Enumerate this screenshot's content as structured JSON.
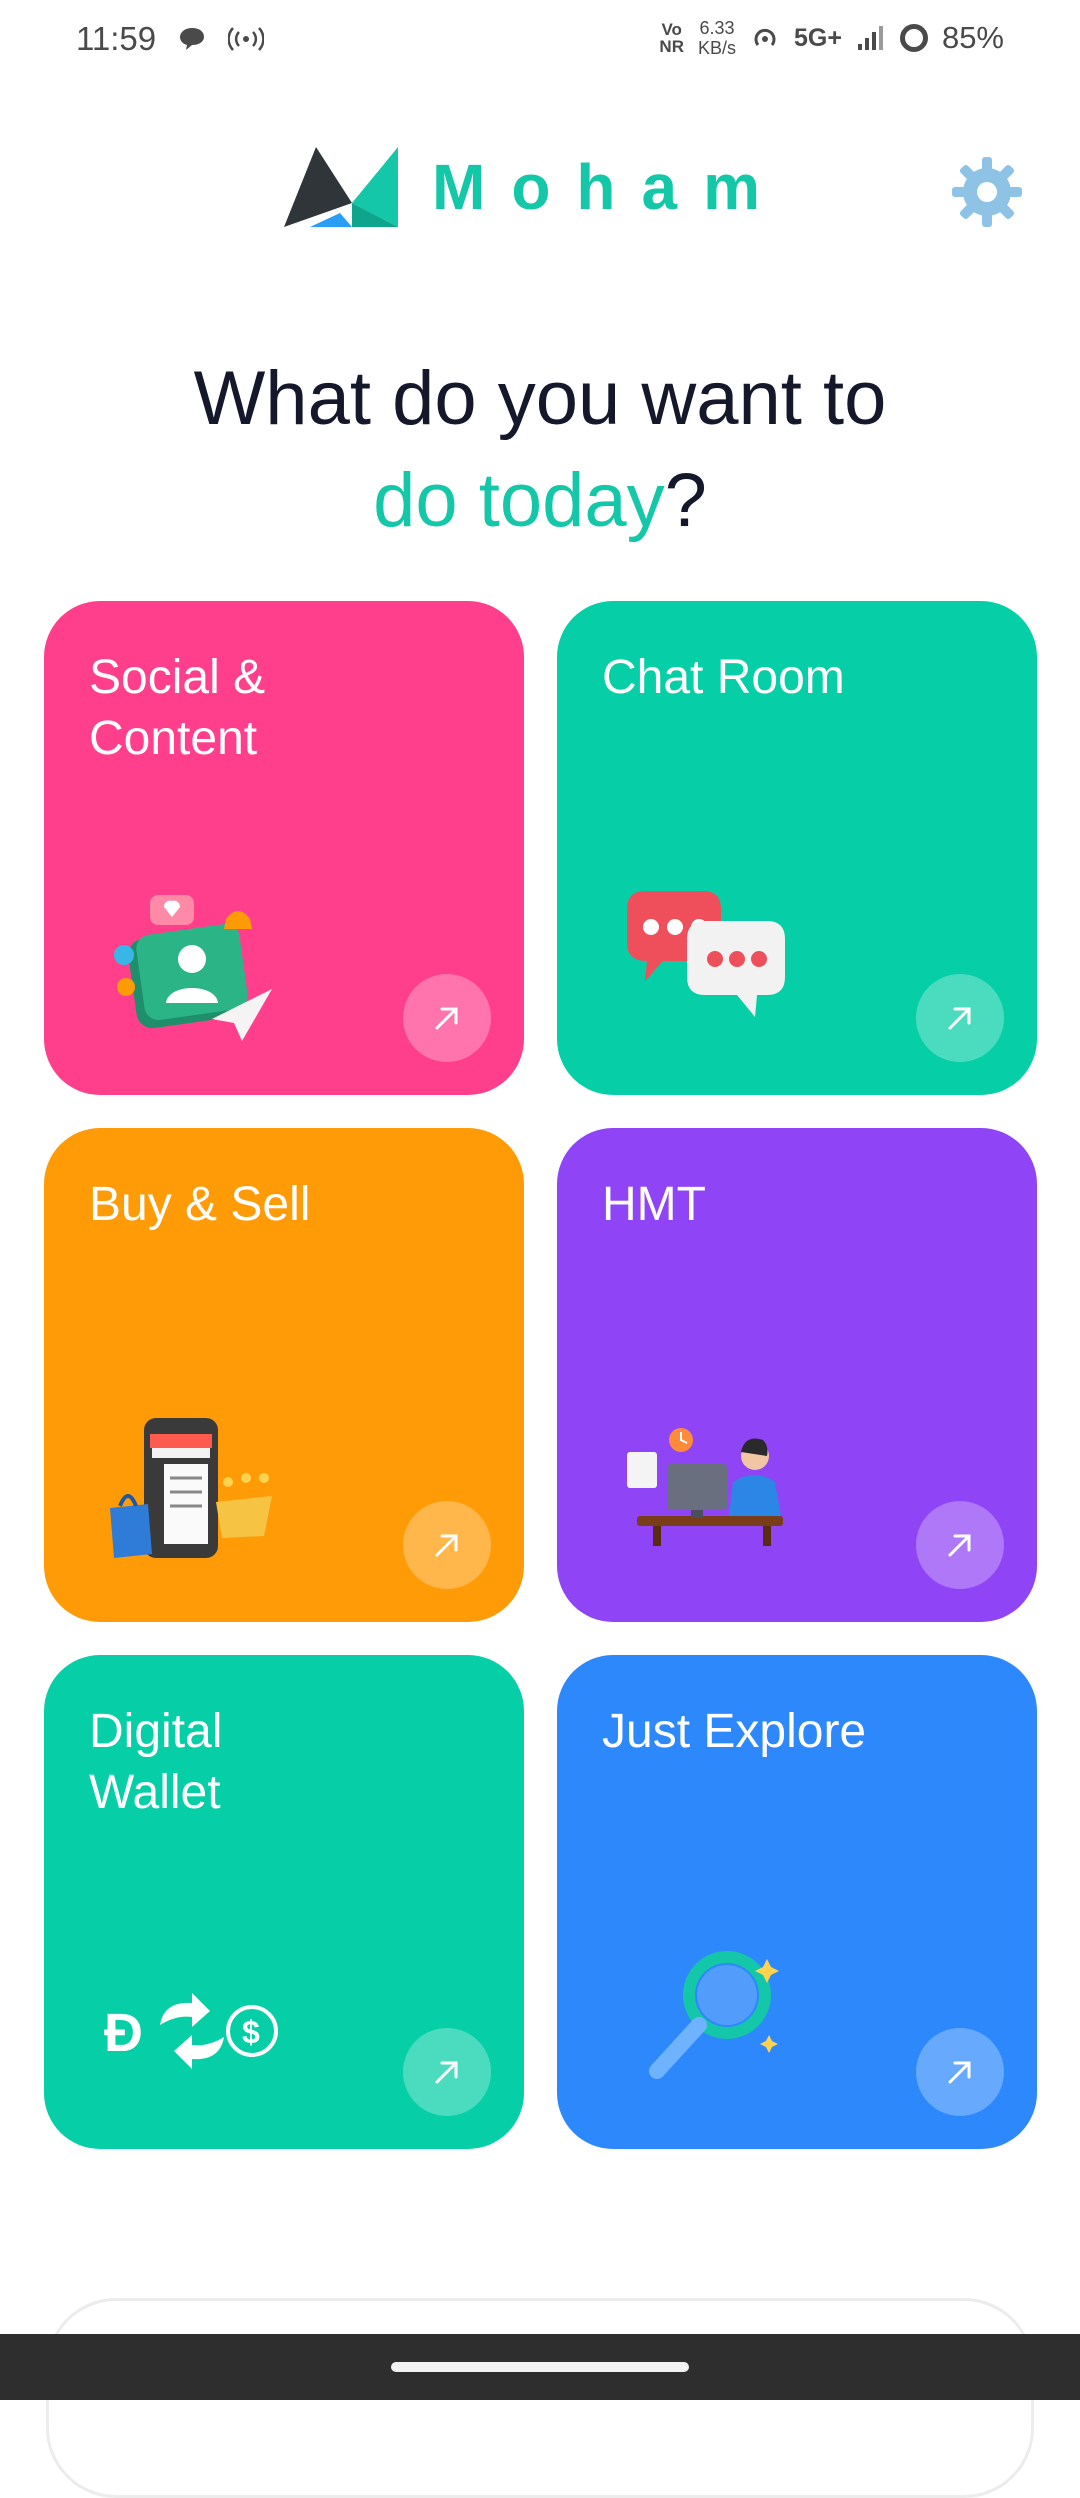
{
  "status_bar": {
    "time": "11:59",
    "volte_top": "Vo",
    "volte_bottom": "NR",
    "speed_value": "6.33",
    "speed_unit": "KB/s",
    "network": "5G+",
    "battery": "85%",
    "icons": [
      "chat-bubble-icon",
      "hotspot-icon",
      "wifi-calling-icon",
      "signal-icon",
      "battery-icon"
    ]
  },
  "header": {
    "brand": "Moham",
    "brand_color": "#14c7a8",
    "settings_icon": "gear-icon"
  },
  "heading": {
    "line1": "What do you want to",
    "accent": "do today",
    "question_mark": "?"
  },
  "cards": [
    {
      "title": "Social &\nContent",
      "color": "#ff3f8c",
      "icon": "social-profile-icon"
    },
    {
      "title": "Chat Room",
      "color": "#06cfa8",
      "icon": "chat-bubbles-icon"
    },
    {
      "title": "Buy & Sell",
      "color": "#ff9b07",
      "icon": "shopping-icon"
    },
    {
      "title": "HMT",
      "color": "#8f45f6",
      "icon": "person-at-computer-icon"
    },
    {
      "title": "Digital\nWallet",
      "color": "#06cfa8",
      "icon": "currency-exchange-icon"
    },
    {
      "title": "Just Explore",
      "color": "#2d88fb",
      "icon": "magnifier-icon"
    }
  ],
  "colors": {
    "text_dark": "#15172b",
    "accent": "#14c7a8"
  }
}
